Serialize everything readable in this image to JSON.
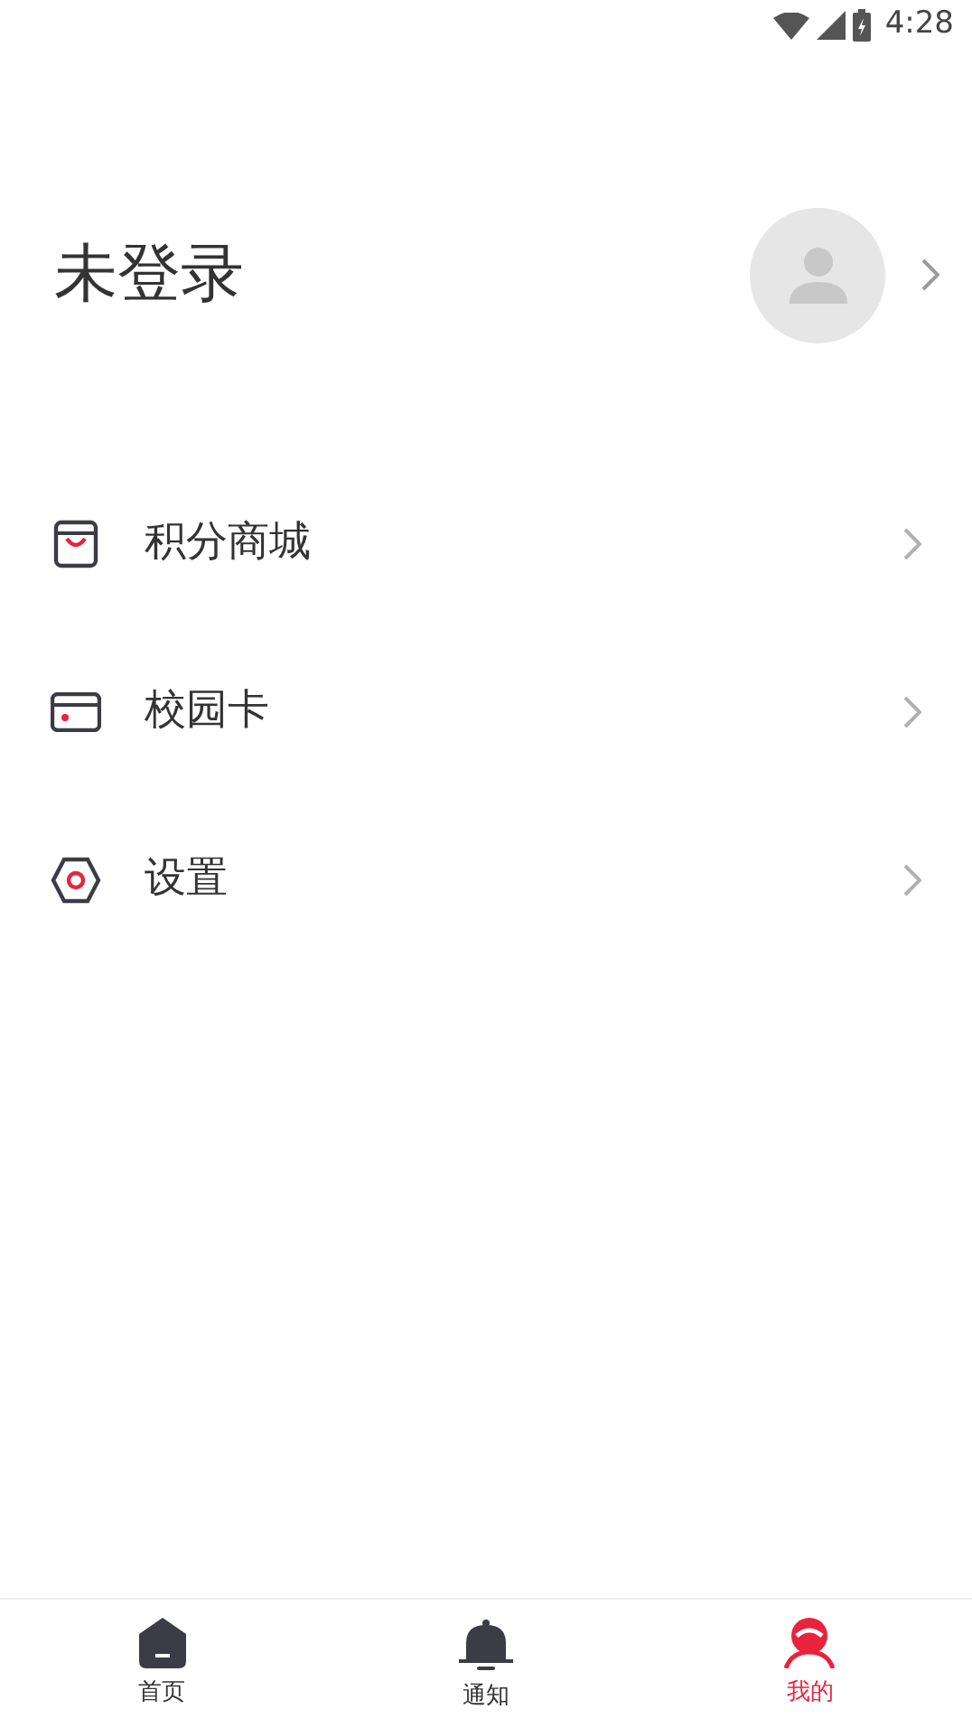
{
  "status_bar": {
    "time": "4:28"
  },
  "profile": {
    "name": "未登录"
  },
  "menu": [
    {
      "kind": "bag",
      "label": "积分商城"
    },
    {
      "kind": "card",
      "label": "校园卡"
    },
    {
      "kind": "hexagon",
      "label": "设置"
    }
  ],
  "tabs": [
    {
      "kind": "home",
      "label": "首页",
      "selected": false
    },
    {
      "kind": "bell",
      "label": "通知",
      "selected": false
    },
    {
      "kind": "person",
      "label": "我的",
      "selected": true
    }
  ]
}
